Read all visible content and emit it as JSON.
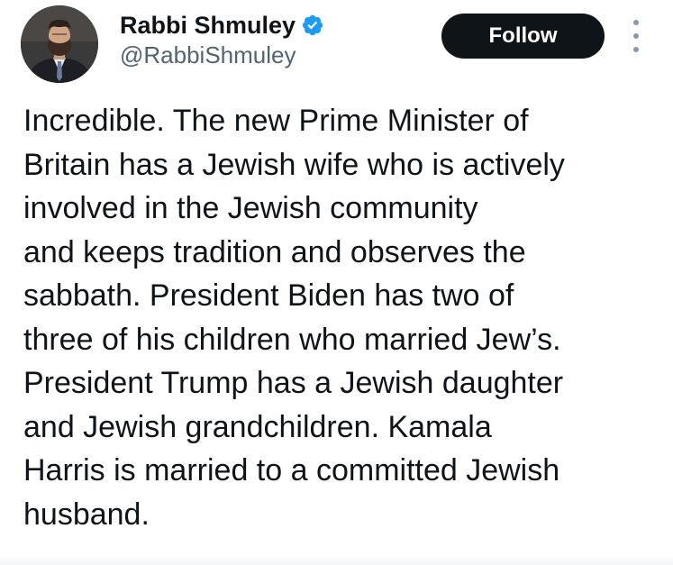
{
  "post": {
    "author": {
      "display_name": "Rabbi Shmuley",
      "handle": "@RabbiShmuley",
      "verified": true,
      "avatar_icon": "profile-photo"
    },
    "follow_label": "Follow",
    "more_icon": "vertical-ellipsis-icon",
    "text": "Incredible. The new Prime Minister of\nBritain has a Jewish wife who is actively\ninvolved in the Jewish community\nand keeps tradition and observes the\nsabbath. President Biden has two of\nthree of his children who married Jew’s.\nPresident Trump has a Jewish daughter\nand Jewish grandchildren. Kamala\nHarris is married to a committed Jewish\nhusband."
  },
  "colors": {
    "text_primary": "#0f1419",
    "text_secondary": "#536471",
    "follow_bg": "#0f1419",
    "follow_text": "#ffffff",
    "verified_badge": "#1d9bf0"
  }
}
